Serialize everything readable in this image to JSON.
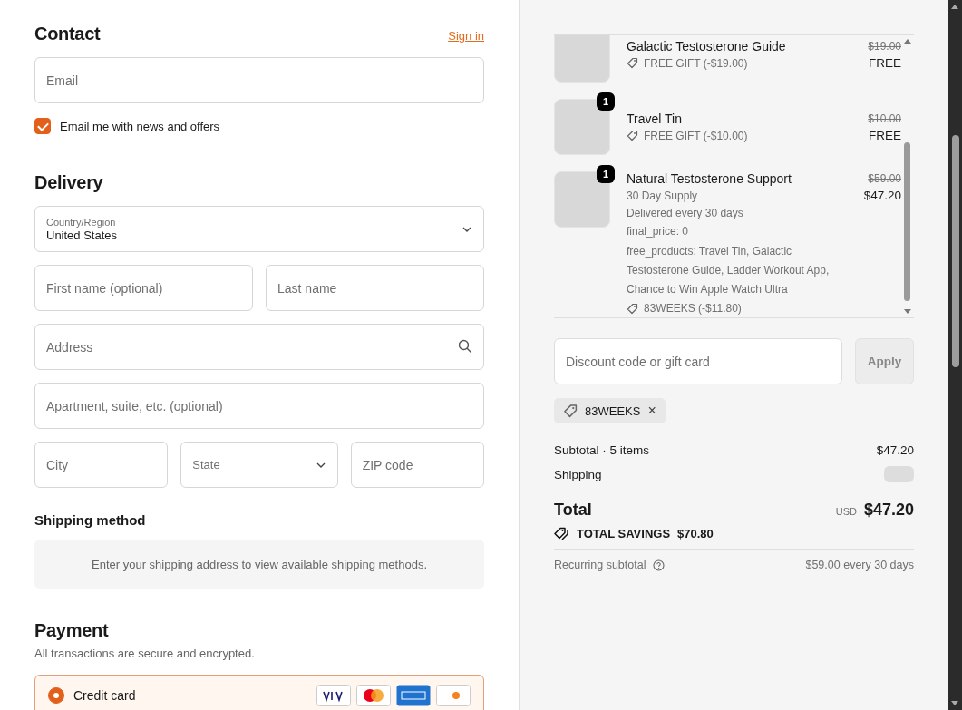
{
  "contact": {
    "title": "Contact",
    "sign_in": "Sign in",
    "email": {
      "placeholder": "Email"
    },
    "news": {
      "label": "Email me with news and offers",
      "checked": true
    }
  },
  "delivery": {
    "title": "Delivery",
    "country": {
      "label": "Country/Region",
      "value": "United States"
    },
    "rows": [
      [
        {
          "kind": "text",
          "placeholder": "First name (optional)"
        },
        {
          "kind": "text",
          "placeholder": "Last name"
        }
      ],
      [
        {
          "kind": "search",
          "placeholder": "Address"
        }
      ],
      [
        {
          "kind": "text",
          "placeholder": "Apartment, suite, etc. (optional)"
        }
      ],
      [
        {
          "kind": "text",
          "placeholder": "City"
        },
        {
          "kind": "select",
          "placeholder": "State"
        },
        {
          "kind": "text",
          "placeholder": "ZIP code"
        }
      ]
    ]
  },
  "shipping_method": {
    "title": "Shipping method",
    "message": "Enter your shipping address to view available shipping methods."
  },
  "payment": {
    "title": "Payment",
    "subtitle": "All transactions are secure and encrypted.",
    "option": {
      "label": "Credit card",
      "selected": true
    }
  },
  "summary": {
    "items": [
      {
        "name": "Galactic Testosterone Guide",
        "lines": [
          {
            "kind": "discount",
            "text": "FREE GIFT (-$19.00)"
          }
        ],
        "compare_price": "$19.00",
        "price": "FREE"
      },
      {
        "name": "Travel Tin",
        "quantity": "1",
        "lines": [
          {
            "kind": "discount",
            "text": "FREE GIFT (-$10.00)"
          }
        ],
        "compare_price": "$10.00",
        "price": "FREE"
      },
      {
        "name": "Natural Testosterone Support",
        "quantity": "1",
        "lines": [
          {
            "kind": "text",
            "text": "30 Day Supply"
          },
          {
            "kind": "text",
            "text": "Delivered every 30 days"
          },
          {
            "kind": "property",
            "text": "final_price: 0"
          },
          {
            "kind": "property",
            "text": "free_products: Travel Tin, Galactic Testosterone Guide, Ladder Workout App, Chance to Win Apple Watch Ultra"
          },
          {
            "kind": "discount",
            "text": "83WEEKS (-$11.80)"
          }
        ],
        "compare_price": "$59.00",
        "price": "$47.20"
      }
    ],
    "discount": {
      "placeholder": "Discount code or gift card",
      "apply": "Apply",
      "codes": [
        {
          "code": "83WEEKS",
          "remove": "×"
        }
      ]
    },
    "subtotal": {
      "label": "Subtotal · 5 items",
      "value": "$47.20"
    },
    "shipping": {
      "label": "Shipping"
    },
    "total": {
      "label": "Total",
      "currency": "USD",
      "value": "$47.20"
    },
    "savings": {
      "label": "TOTAL SAVINGS",
      "value": "$70.80"
    },
    "recurring": {
      "label": "Recurring subtotal",
      "value": "$59.00 every 30 days"
    }
  }
}
